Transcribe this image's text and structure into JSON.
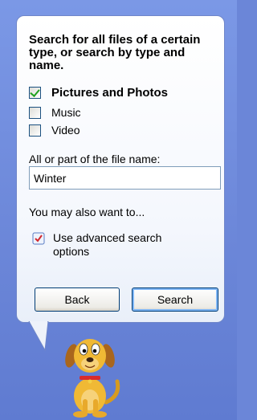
{
  "search_companion": {
    "heading": "Search for all files of a certain type, or search by type and name.",
    "options": [
      {
        "label": "Pictures and Photos",
        "checked": true
      },
      {
        "label": "Music",
        "checked": false
      },
      {
        "label": "Video",
        "checked": false
      }
    ],
    "file_name_label": "All or part of the file name:",
    "file_name_value": "Winter",
    "also_want_text": "You may also want to...",
    "advanced_option_label": "Use advanced search options",
    "back_button": "Back",
    "search_button": "Search"
  },
  "colors": {
    "pane_background": "#6b86d8",
    "button_border": "#003c74",
    "checkmark": "#21a121"
  },
  "icons": [
    "checkbox-checked-icon",
    "advanced-options-icon",
    "search-dog-character"
  ]
}
